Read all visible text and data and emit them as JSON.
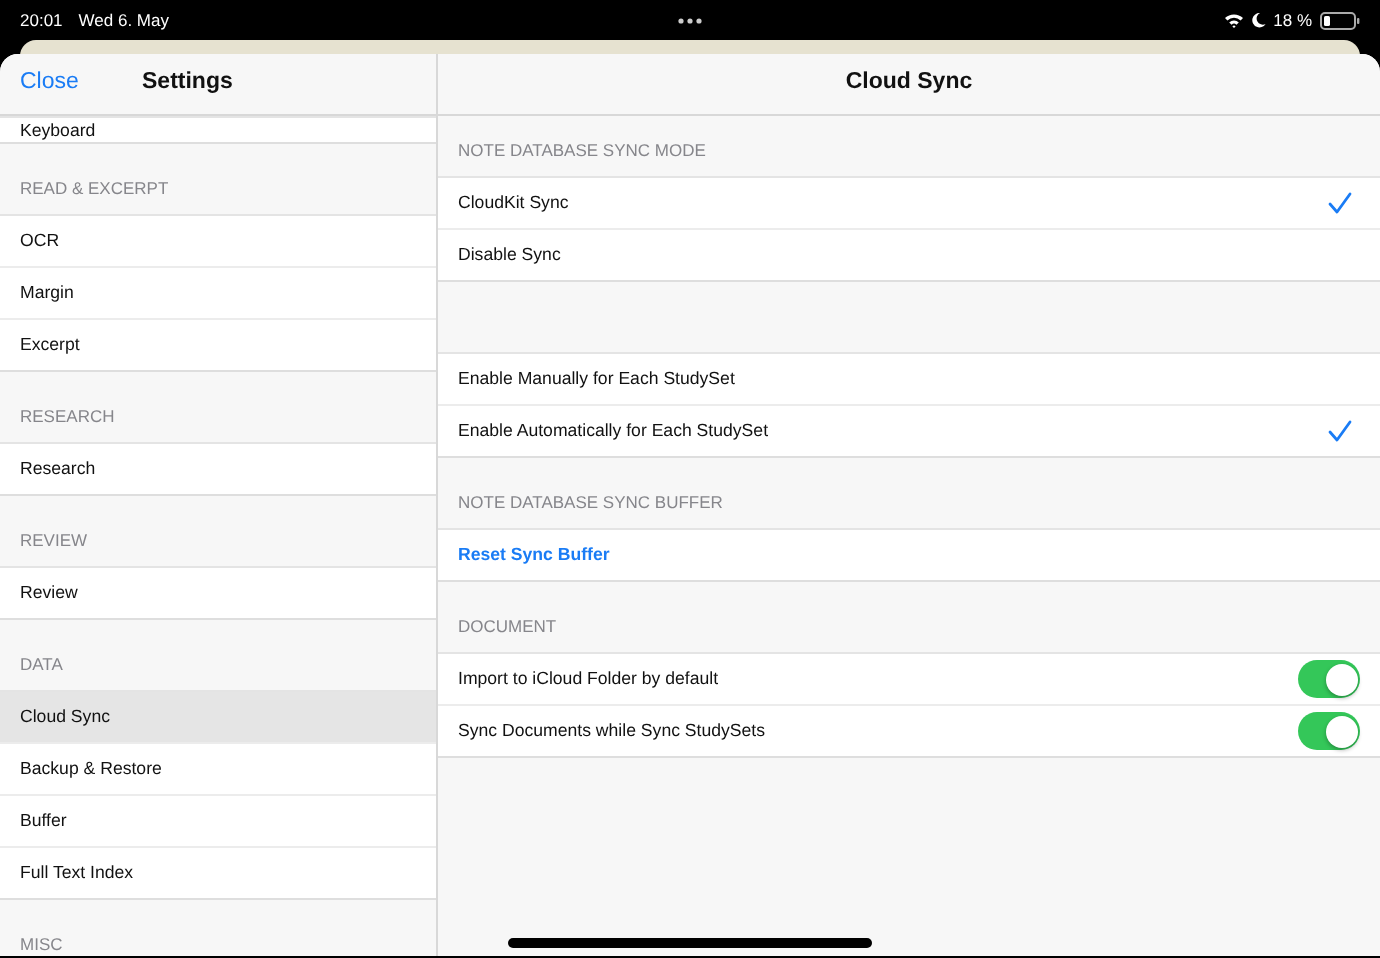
{
  "status_bar": {
    "time": "20:01",
    "date": "Wed 6. May",
    "battery": "18 %"
  },
  "sidebar": {
    "close_button": "Close",
    "title": "Settings",
    "sections": [
      {
        "items": [
          {
            "label": "Keyboard",
            "selected": false
          }
        ]
      },
      {
        "header": "READ & EXCERPT",
        "items": [
          {
            "label": "OCR",
            "selected": false
          },
          {
            "label": "Margin",
            "selected": false
          },
          {
            "label": "Excerpt",
            "selected": false
          }
        ]
      },
      {
        "header": "RESEARCH",
        "items": [
          {
            "label": "Research",
            "selected": false
          }
        ]
      },
      {
        "header": "REVIEW",
        "items": [
          {
            "label": "Review",
            "selected": false
          }
        ]
      },
      {
        "header": "DATA",
        "items": [
          {
            "label": "Cloud Sync",
            "selected": true
          },
          {
            "label": "Backup & Restore",
            "selected": false
          },
          {
            "label": "Buffer",
            "selected": false
          },
          {
            "label": "Full Text Index",
            "selected": false
          }
        ]
      },
      {
        "header": "MISC"
      }
    ]
  },
  "detail": {
    "title": "Cloud Sync",
    "sections": [
      {
        "header": "NOTE DATABASE SYNC MODE",
        "rows": [
          {
            "kind": "check",
            "label": "CloudKit Sync",
            "checked": true
          },
          {
            "kind": "check",
            "label": "Disable Sync",
            "checked": false
          }
        ]
      },
      {
        "rows": [
          {
            "kind": "check",
            "label": "Enable Manually for Each StudySet",
            "checked": false
          },
          {
            "kind": "check",
            "label": "Enable Automatically for Each StudySet",
            "checked": true
          }
        ]
      },
      {
        "header": "NOTE DATABASE SYNC BUFFER",
        "rows": [
          {
            "kind": "action",
            "label": "Reset Sync Buffer"
          }
        ]
      },
      {
        "header": "DOCUMENT",
        "rows": [
          {
            "kind": "toggle",
            "label": "Import to iCloud Folder by default",
            "on": true
          },
          {
            "kind": "toggle",
            "label": "Sync Documents while Sync StudySets",
            "on": true
          }
        ]
      }
    ]
  }
}
